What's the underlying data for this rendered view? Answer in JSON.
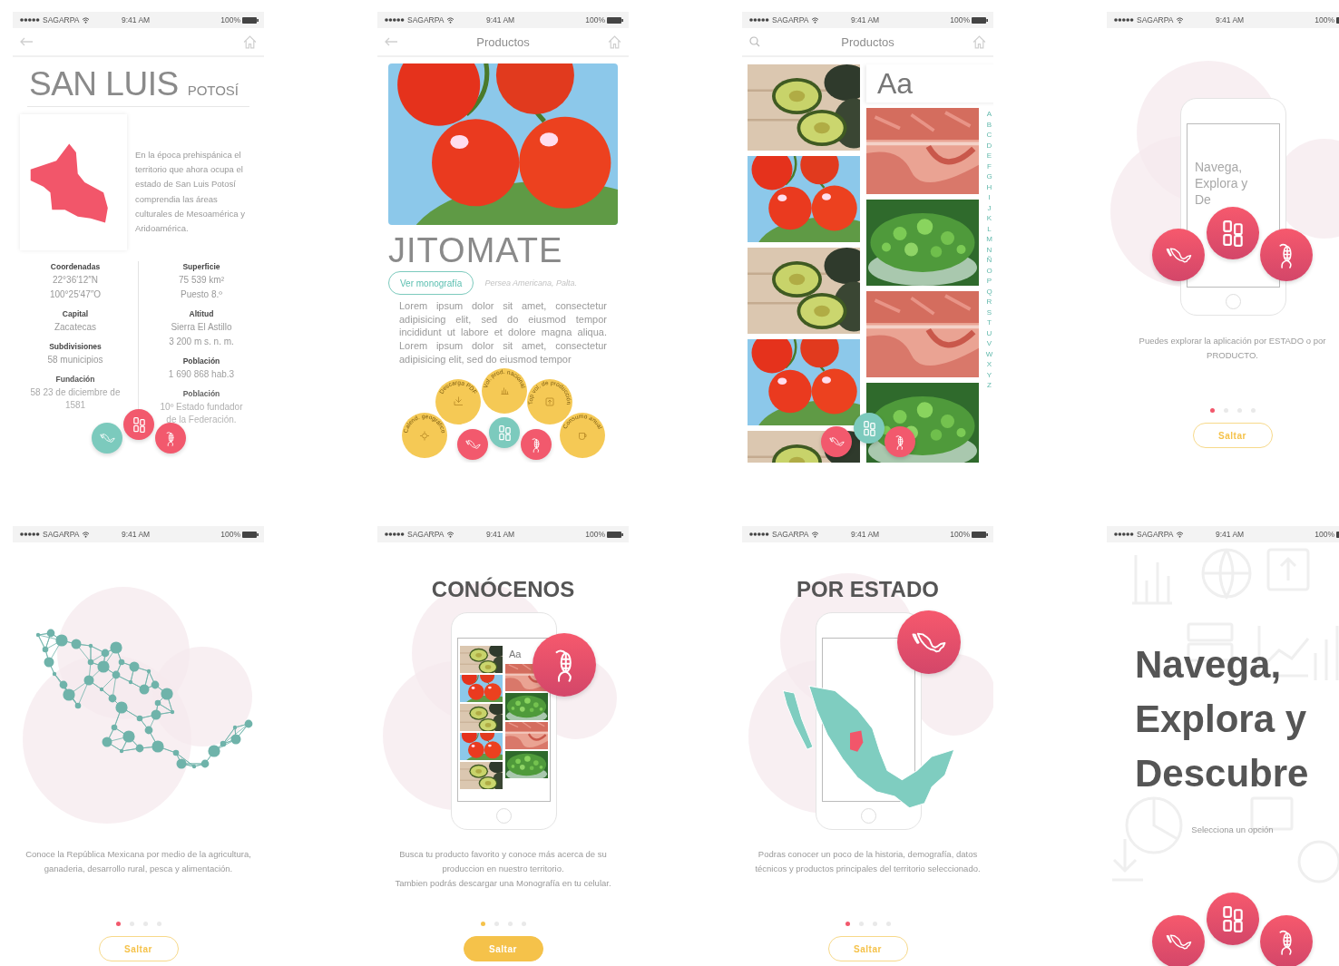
{
  "screens": [
    {
      "kind": "state_detail",
      "status": {
        "carrier": "SAGARPA",
        "time": "9:41 AM",
        "battery": "100%"
      },
      "nav": {
        "kind": "back"
      },
      "title": "SAN LUIS",
      "subtitle": "POTOSÍ",
      "description": "En la época prehispánica el territorio que ahora ocupa el estado de San Luis Potosí comprendia las áreas culturales de Mesoamérica y Aridoamérica.",
      "stats": [
        [
          {
            "label": "Coordenadas",
            "lines": [
              "22°36′12″N",
              "100°25′47″O"
            ]
          },
          {
            "label": "Capital",
            "lines": [
              "Zacatecas"
            ]
          },
          {
            "label": "Subdivisiones",
            "lines": [
              "58 municipios"
            ]
          },
          {
            "label": "Fundación",
            "lines": [
              "58 23 de diciembre de 1581"
            ]
          }
        ],
        [
          {
            "label": "Superficie",
            "lines": [
              "75 539 km²",
              "Puesto 8.º"
            ]
          },
          {
            "label": "Altitud",
            "lines": [
              "Sierra El Astillo",
              "3 200 m s. n. m."
            ]
          },
          {
            "label": "Población",
            "lines": [
              "1 690 868 hab.3"
            ]
          },
          {
            "label": "Población",
            "lines": [
              "10º Estado fundador de la Federación."
            ]
          }
        ]
      ],
      "fabs": [
        {
          "selected": true
        },
        {
          "selected": false
        },
        {
          "selected": false
        }
      ]
    },
    {
      "kind": "product_detail",
      "status": {
        "carrier": "SAGARPA",
        "time": "9:41 AM",
        "battery": "100%"
      },
      "nav": {
        "kind": "back",
        "title": "Productos"
      },
      "photo": {
        "kind": "picture"
      },
      "product": "JITOMATE",
      "action": "Ver monografía",
      "species": "Persea Americana, Palta.",
      "paragraphs": [
        "Lorem ipsum dolor sit amet, consectetur adipisicing elit, sed do eiusmod tempor incididunt ut labore et dolore magna aliqua. Lorem ipsum dolor sit amet, consectetur adipisicing elit, sed do eiusmod tempor"
      ],
      "options": [
        {
          "label": "Descarga PDF"
        },
        {
          "label": "Vol. prod. nacional"
        },
        {
          "label": "Top vol. de producción"
        },
        {
          "label": "Calend. geográfico"
        },
        {
          "label": "Consumo anual"
        }
      ],
      "fabs": [
        {
          "selected": false
        },
        {
          "selected": true
        },
        {
          "selected": false
        }
      ]
    },
    {
      "kind": "product_list",
      "status": {
        "carrier": "SAGARPA",
        "time": "9:41 AM",
        "battery": "100%"
      },
      "nav": {
        "kind": "search",
        "title": "Productos"
      },
      "index_header": "Aa",
      "left_tiles": [
        {
          "kind": "picture"
        },
        {
          "kind": "picture"
        },
        {
          "kind": "picture"
        },
        {
          "kind": "picture"
        },
        {
          "kind": "picture"
        }
      ],
      "right_tiles": [
        {
          "kind": "picture"
        },
        {
          "kind": "picture"
        },
        {
          "kind": "picture"
        },
        {
          "kind": "picture"
        }
      ],
      "letters": [
        "A",
        "B",
        "C",
        "D",
        "E",
        "F",
        "G",
        "H",
        "I",
        "J",
        "K",
        "L",
        "M",
        "N",
        "Ñ",
        "O",
        "P",
        "Q",
        "R",
        "S",
        "T",
        "U",
        "V",
        "W",
        "X",
        "Y",
        "Z"
      ],
      "fabs": [
        {
          "selected": false
        },
        {
          "selected": true
        },
        {
          "selected": false
        }
      ]
    },
    {
      "kind": "intro_overlay",
      "status": {
        "carrier": "SAGARPA",
        "time": "9:41 AM",
        "battery": "100%"
      },
      "preview_text": "Navega, Explora y De",
      "fabs": [
        {
          "selected": false
        },
        {
          "selected": false
        },
        {
          "selected": false
        }
      ],
      "caption": "Puedes explorar la aplicación por ESTADO o por PRODUCTO.",
      "pages": [
        {
          "selected": true
        },
        {
          "selected": false
        },
        {
          "selected": false
        },
        {
          "selected": false
        }
      ],
      "skip": {
        "label": "Saltar",
        "filled": false
      }
    },
    {
      "kind": "onboarding_network",
      "status": {
        "carrier": "SAGARPA",
        "time": "9:41 AM",
        "battery": "100%"
      },
      "caption": "Conoce la República Mexicana por medio de la agricultura, ganaderia, desarrollo rural, pesca y alimentación.",
      "pages": [
        {
          "selected": true
        },
        {
          "selected": false
        },
        {
          "selected": false
        },
        {
          "selected": false
        }
      ],
      "skip": {
        "label": "Saltar",
        "filled": false
      }
    },
    {
      "kind": "onboarding_products",
      "status": {
        "carrier": "SAGARPA",
        "time": "9:41 AM",
        "battery": "100%"
      },
      "heading": "CONÓCENOS",
      "preview_header": "Aa",
      "preview_left": [
        {
          "kind": "picture"
        },
        {
          "kind": "picture"
        },
        {
          "kind": "picture"
        },
        {
          "kind": "picture"
        },
        {
          "kind": "picture"
        }
      ],
      "preview_right": [
        {
          "kind": "picture"
        },
        {
          "kind": "picture"
        },
        {
          "kind": "picture"
        },
        {
          "kind": "picture"
        }
      ],
      "caption": "Busca tu producto favorito y conoce más acerca de su produccion en nuestro territorio.\nTambien podrás descargar una Monografía en tu celular.",
      "pages": [
        {
          "selected": true
        },
        {
          "selected": false
        },
        {
          "selected": false
        },
        {
          "selected": false
        }
      ],
      "skip": {
        "label": "Saltar",
        "filled": true
      }
    },
    {
      "kind": "onboarding_states",
      "status": {
        "carrier": "SAGARPA",
        "time": "9:41 AM",
        "battery": "100%"
      },
      "heading": "POR ESTADO",
      "caption": "Podras conocer un poco de la historia, demografía, datos técnicos y productos principales del territorio seleccionado.",
      "pages": [
        {
          "selected": true
        },
        {
          "selected": false
        },
        {
          "selected": false
        },
        {
          "selected": false
        }
      ],
      "skip": {
        "label": "Saltar",
        "filled": false
      }
    },
    {
      "kind": "splash",
      "status": {
        "carrier": "SAGARPA",
        "time": "9:41 AM",
        "battery": "100%"
      },
      "headline": "Navega, Explora y Descubre",
      "hint": "Selecciona un opción",
      "fabs": [
        {
          "selected": false
        },
        {
          "selected": false
        },
        {
          "selected": false
        }
      ]
    }
  ]
}
